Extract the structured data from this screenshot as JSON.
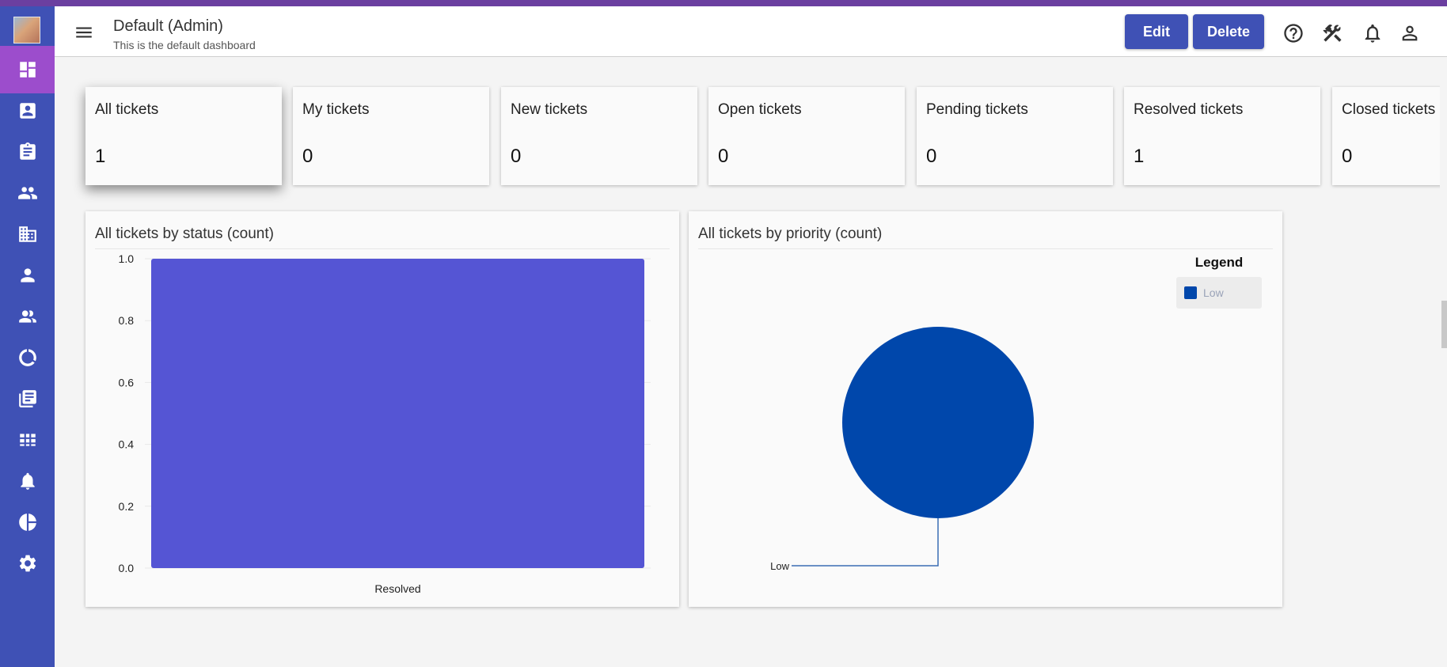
{
  "header": {
    "title": "Default (Admin)",
    "subtitle": "This is the default dashboard",
    "edit_label": "Edit",
    "delete_label": "Delete",
    "icons": [
      "help-icon",
      "tools-icon",
      "bell-icon",
      "account-icon"
    ]
  },
  "sidebar": {
    "items": [
      {
        "icon": "dashboard-icon",
        "active": true
      },
      {
        "icon": "contact-card-icon"
      },
      {
        "icon": "clipboard-icon"
      },
      {
        "icon": "people-icon"
      },
      {
        "icon": "building-icon"
      },
      {
        "icon": "person-icon"
      },
      {
        "icon": "group-icon"
      },
      {
        "icon": "progress-circle-icon"
      },
      {
        "icon": "library-icon"
      },
      {
        "icon": "grid-icon"
      },
      {
        "icon": "bell-icon"
      },
      {
        "icon": "pie-chart-icon"
      },
      {
        "icon": "gear-icon"
      }
    ],
    "active_color": "#9c4dcc",
    "background_color": "#3f51b5"
  },
  "cards": [
    {
      "label": "All tickets",
      "value": "1"
    },
    {
      "label": "My tickets",
      "value": "0"
    },
    {
      "label": "New tickets",
      "value": "0"
    },
    {
      "label": "Open tickets",
      "value": "0"
    },
    {
      "label": "Pending tickets",
      "value": "0"
    },
    {
      "label": "Resolved tickets",
      "value": "1"
    },
    {
      "label": "Closed tickets",
      "value": "0"
    }
  ],
  "status_chart": {
    "title": "All tickets by status (count)"
  },
  "priority_chart": {
    "title": "All tickets by priority (count)",
    "legend_title": "Legend",
    "legend_items": [
      "Low"
    ]
  },
  "chart_data": [
    {
      "type": "bar",
      "title": "All tickets by status (count)",
      "categories": [
        "Resolved"
      ],
      "values": [
        1
      ],
      "ylim": [
        0,
        1
      ],
      "yticks": [
        "0.0",
        "0.2",
        "0.4",
        "0.6",
        "0.8",
        "1.0"
      ],
      "color": "#5555d4"
    },
    {
      "type": "pie",
      "title": "All tickets by priority (count)",
      "categories": [
        "Low"
      ],
      "values": [
        1
      ],
      "colors": [
        "#0047ab"
      ],
      "legend": "top-right"
    }
  ]
}
